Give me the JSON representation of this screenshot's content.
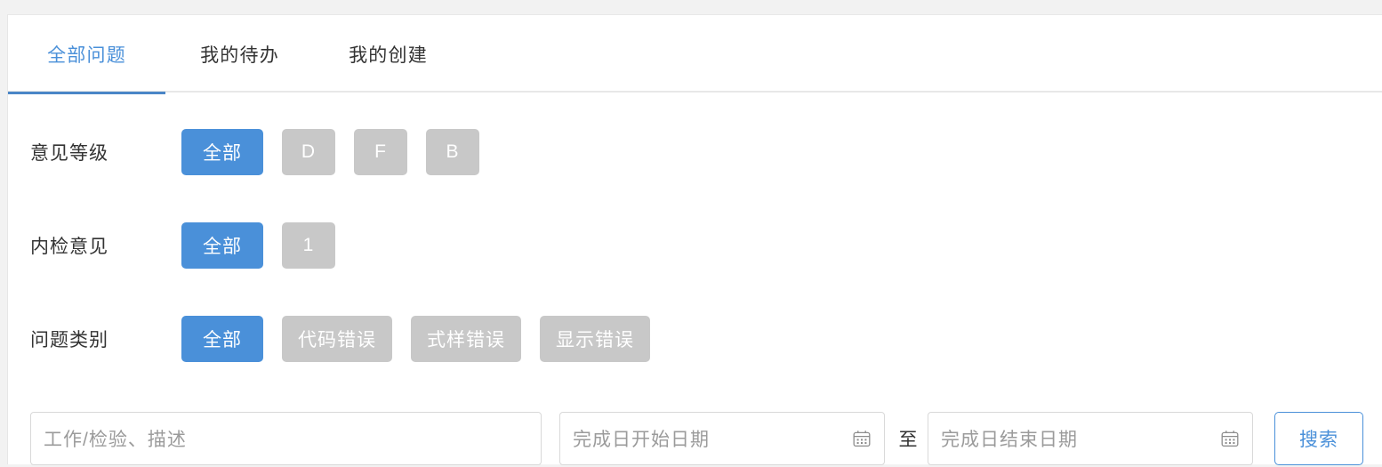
{
  "tabs": [
    {
      "label": "全部问题",
      "active": true
    },
    {
      "label": "我的待办",
      "active": false
    },
    {
      "label": "我的创建",
      "active": false
    }
  ],
  "filters": [
    {
      "label": "意见等级",
      "options": [
        {
          "label": "全部",
          "active": true
        },
        {
          "label": "D",
          "active": false
        },
        {
          "label": "F",
          "active": false
        },
        {
          "label": "B",
          "active": false
        }
      ]
    },
    {
      "label": "内检意见",
      "options": [
        {
          "label": "全部",
          "active": true
        },
        {
          "label": "1",
          "active": false
        }
      ]
    },
    {
      "label": "问题类别",
      "options": [
        {
          "label": "全部",
          "active": true
        },
        {
          "label": "代码错误",
          "active": false
        },
        {
          "label": "式样错误",
          "active": false
        },
        {
          "label": "显示错误",
          "active": false
        }
      ]
    }
  ],
  "search": {
    "keyword_placeholder": "工作/检验、描述",
    "keyword_value": "",
    "date_start_placeholder": "完成日开始日期",
    "date_start_value": "",
    "date_end_placeholder": "完成日结束日期",
    "date_end_value": "",
    "date_separator": "至",
    "submit_label": "搜索",
    "calendar_icon": "calendar-icon"
  },
  "colors": {
    "accent": "#4a90d9",
    "chip_inactive": "#c8c8c8",
    "page_background": "#f2f2f2",
    "card_background": "#ffffff",
    "text": "#333333",
    "placeholder": "#9b9b9b",
    "border": "#d9d9d9"
  }
}
